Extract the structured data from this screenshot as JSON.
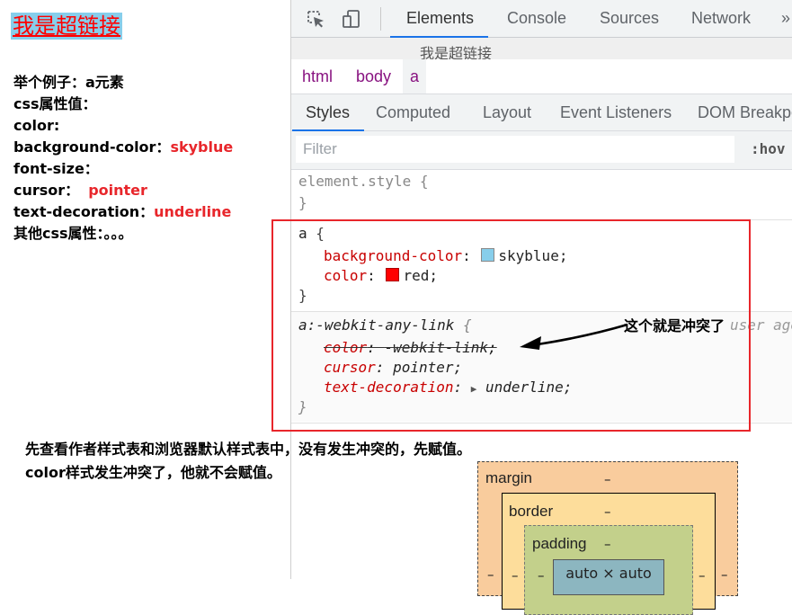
{
  "page": {
    "link_text": "我是超链接",
    "notes": [
      {
        "label": "举个例子：a元素",
        "value": ""
      },
      {
        "label": "css属性值：",
        "value": ""
      },
      {
        "label": "color:",
        "value": ""
      },
      {
        "label": "background-color：",
        "value": "skyblue"
      },
      {
        "label": "font-size：",
        "value": ""
      },
      {
        "label": "cursor：",
        "value": "pointer"
      },
      {
        "label": "text-decoration：",
        "value": "underline"
      },
      {
        "label": "其他css属性：。。。",
        "value": ""
      }
    ],
    "bottom_notes": [
      "先查看作者样式表和浏览器默认样式表中，没有发生冲突的，先赋值。",
      "color样式发生冲突了，他就不会赋值。"
    ]
  },
  "devtools": {
    "icons": {
      "inspect": "inspect-element-icon",
      "device": "device-toggle-icon",
      "more": "more-tabs-icon"
    },
    "main_tabs": [
      "Elements",
      "Console",
      "Sources",
      "Network"
    ],
    "more_tabs_glyph": "»",
    "tooltip_text": "我是超链接",
    "breadcrumbs": [
      "html",
      "body",
      "a"
    ],
    "sub_tabs": [
      "Styles",
      "Computed",
      "Layout",
      "Event Listeners",
      "DOM Breakpoints"
    ],
    "filter_placeholder": "Filter",
    "hov_label": ":hov",
    "element_style": {
      "selector": "element.style",
      "open": "{",
      "close": "}"
    },
    "author_rule": {
      "selector": "a",
      "open": "{",
      "close": "}",
      "declarations": [
        {
          "prop": "background-color",
          "value": "skyblue",
          "swatch": "#87ceeb"
        },
        {
          "prop": "color",
          "value": "red",
          "swatch": "#ff0000"
        }
      ]
    },
    "ua_rule": {
      "selector": "a:-webkit-any-link",
      "open": "{",
      "close": "}",
      "source": "user agent stylesheet",
      "declarations": [
        {
          "prop": "color",
          "value": "-webkit-link",
          "overridden": true
        },
        {
          "prop": "cursor",
          "value": "pointer",
          "overridden": false
        },
        {
          "prop": "text-decoration",
          "value": "underline",
          "overridden": false,
          "expandable": true
        }
      ]
    },
    "box_model": {
      "margin_label": "margin",
      "border_label": "border",
      "padding_label": "padding",
      "content_label": "auto × auto",
      "dash": "–"
    }
  },
  "annotation": {
    "label": "这个就是冲突了",
    "color": "#e8262b"
  }
}
